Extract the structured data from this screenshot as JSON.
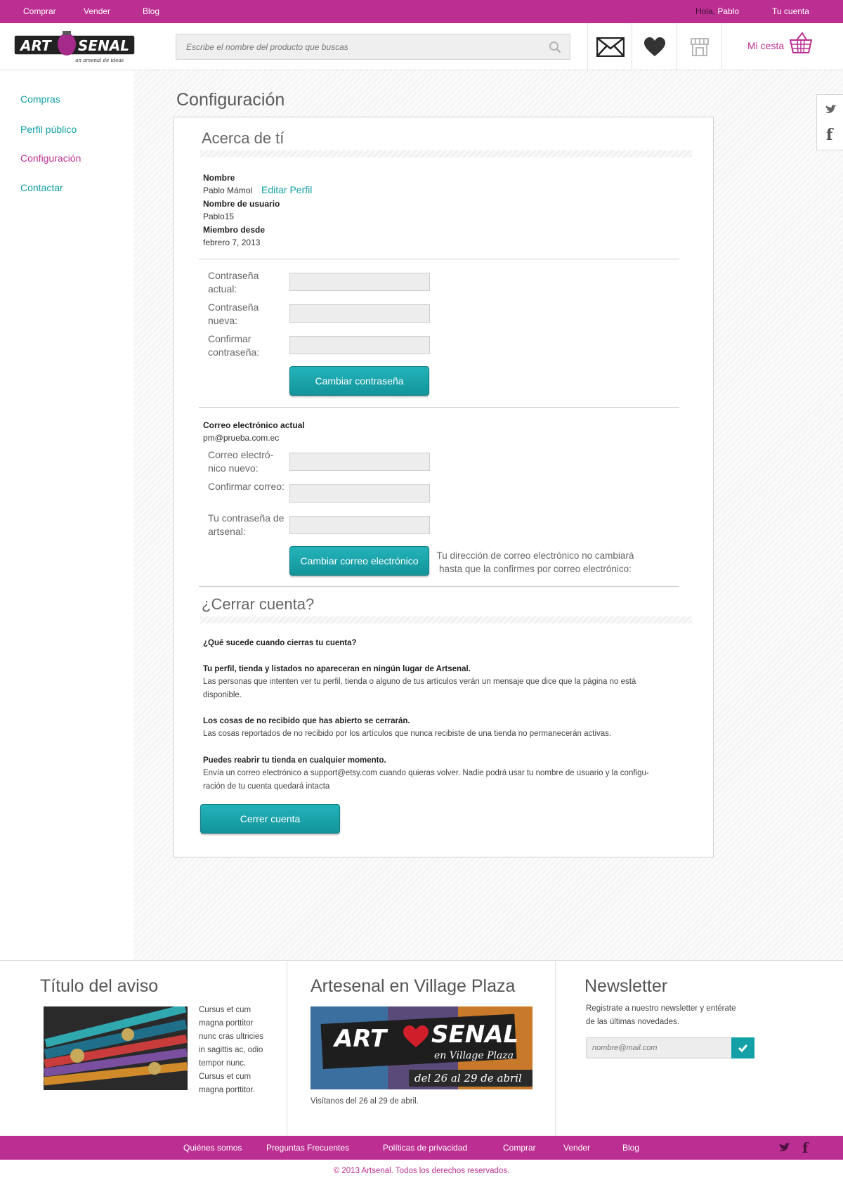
{
  "topbar": {
    "links": [
      "Comprar",
      "Vender",
      "Blog"
    ],
    "greeting_word": "Hola,",
    "user": "Pablo",
    "account": "Tu cuenta"
  },
  "brand": {
    "left": "ART",
    "right": "SENAL",
    "tagline": "un arsenal de ideas"
  },
  "search": {
    "placeholder": "Escribe el nombre del producto que buscas"
  },
  "cart": {
    "label": "Mi cesta"
  },
  "sidenav": {
    "items": [
      {
        "label": "Compras"
      },
      {
        "label": "Perfil público"
      },
      {
        "label": "Configuración"
      },
      {
        "label": "Contactar"
      }
    ]
  },
  "page": {
    "title": "Configuración"
  },
  "about": {
    "heading": "Acerca de tí",
    "name_label": "Nombre",
    "name_value": "Pablo Mámol",
    "edit_link": "Editar Perfil",
    "username_label": "Nombre de usuario",
    "username_value": "Pablo15",
    "member_label": "Miembro desde",
    "member_value": "febrero 7, 2013"
  },
  "password": {
    "current": "Contraseña actual:",
    "new": "Contraseña nueva:",
    "confirm": "Confirmar contraseña:",
    "button": "Cambiar contraseña"
  },
  "email": {
    "current_label": "Correo electrónico actual",
    "current_value": "pm@prueba.com.ec",
    "new": "Correo electró-nico nuevo:",
    "confirm": "Confirmar correo:",
    "password": "Tu contraseña de artsenal:",
    "button": "Cambiar correo electrónico",
    "note_1": "Tu dirección de correo electrónico no cambiará",
    "note_2": "hasta que la confirmes por correo electrónico:"
  },
  "close": {
    "heading": "¿Cerrar cuenta?",
    "question": "¿Qué sucede cuando cierras tu cuenta?",
    "b1_title": "Tu perfil, tienda y listados no apareceran en ningún lugar de Artsenal.",
    "b1_line1": "Las personas que intenten ver tu perfil, tienda o alguno de tus artículos verán un mensaje que dice que la página no está",
    "b1_line2": "disponible.",
    "b2_title": "Los cosas de no recibido que has abierto se cerrarán.",
    "b2_line1": "Las cosas reportados de no recibido por los artículos que nunca recibiste de una tienda no permanecerán activas.",
    "b3_title": "Puedes reabrir tu tienda en cualquier momento.",
    "b3_line1": "Envía un correo electrónico a support@etsy.com cuando quieras volver. Nadie podrá usar tu nombre de usuario y la configu-",
    "b3_line2": "ración de tu cuenta quedará intacta",
    "button": "Cerrer cuenta"
  },
  "footer": {
    "col1": {
      "title": "Título del aviso",
      "text": [
        "Cursus et cum",
        "magna porttitor",
        "nunc cras ultricies",
        "in sagittis ac, odio",
        "tempor nunc.",
        "Cursus et cum",
        "magna porttitor."
      ]
    },
    "col2": {
      "title": "Artesenal en Village Plaza",
      "banner_left": "ART",
      "banner_right": "SENAL",
      "banner_sub": "en Village Plaza",
      "banner_dates": "del 26 al 29 de abril",
      "caption": "Visítanos del 26 al 29 de abril."
    },
    "col3": {
      "title": "Newsletter",
      "text_1": "Registrate a nuestro newsletter y entérate",
      "text_2": "de las últimas novedades.",
      "placeholder": "nombre@mail.com"
    }
  },
  "bottom_links": [
    "Quiénes somos",
    "Preguntas Frecuentes",
    "Políticas de privacidad",
    "Comprar",
    "Vender",
    "Blog"
  ],
  "copyright": "© 2013 Artsenal. Todos los derechos reservados.",
  "colors": {
    "brand": "#bc2f92",
    "accent": "#13a0a7"
  }
}
